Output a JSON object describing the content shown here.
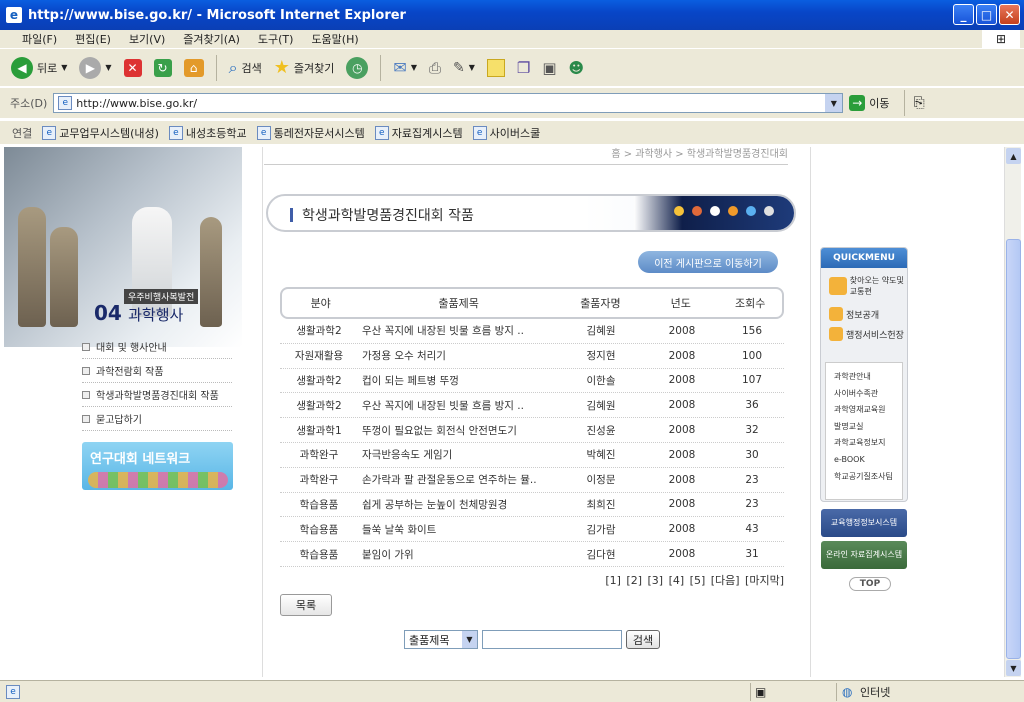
{
  "window": {
    "title": "http://www.bise.go.kr/ - Microsoft Internet Explorer"
  },
  "menu": [
    "파일(F)",
    "편집(E)",
    "보기(V)",
    "즐겨찾기(A)",
    "도구(T)",
    "도움말(H)"
  ],
  "toolbar": {
    "back": "뒤로",
    "search": "검색",
    "favorites": "즐겨찾기"
  },
  "address": {
    "label": "주소(D)",
    "url": "http://www.bise.go.kr/",
    "go": "이동"
  },
  "links": {
    "label": "연결",
    "items": [
      "교무업무시스템(내성)",
      "내성초등학교",
      "통레전자문서시스템",
      "자료집계시스템",
      "사이버스쿨"
    ]
  },
  "left": {
    "hero_label": "우주비행사복발전",
    "section_num": "04",
    "section_title": "과학행사",
    "menu": [
      "대회 및 행사안내",
      "과학전람회 작품",
      "학생과학발명품경진대회 작품",
      "묻고답하기"
    ],
    "banner": "연구대회 네트워크"
  },
  "breadcrumb": "홈 > 과학행사 > 학생과학발명품경진대회",
  "page_title": "학생과학발명품경진대회 작품",
  "prev_board_button": "이전 게시판으로 이동하기",
  "table": {
    "headers": [
      "분야",
      "출품제목",
      "출품자명",
      "년도",
      "조회수"
    ],
    "rows": [
      [
        "생활과학2",
        "우산 꼭지에 내장된 빗물 흐름 방지 ..",
        "김혜원",
        "2008",
        "156"
      ],
      [
        "자원재활용",
        "가정용 오수 처리기",
        "정지현",
        "2008",
        "100"
      ],
      [
        "생활과학2",
        "컵이 되는 페트병 뚜껑",
        "이한솔",
        "2008",
        "107"
      ],
      [
        "생활과학2",
        "우산 꼭지에 내장된 빗물 흐름 방지 ..",
        "김혜원",
        "2008",
        "36"
      ],
      [
        "생활과학1",
        "뚜껑이 필요없는 회전식 안전면도기",
        "진성윤",
        "2008",
        "32"
      ],
      [
        "과학완구",
        "자극반응속도 게임기",
        "박혜진",
        "2008",
        "30"
      ],
      [
        "과학완구",
        "손가락과 팔 관절운동으로 연주하는 뮬..",
        "이정문",
        "2008",
        "23"
      ],
      [
        "학습용품",
        "쉽게 공부하는 눈높이 천체망원경",
        "최희진",
        "2008",
        "23"
      ],
      [
        "학습용품",
        "들쑥 날쑥 화이트",
        "김가람",
        "2008",
        "43"
      ],
      [
        "학습용품",
        "붙임이 가위",
        "김다현",
        "2008",
        "31"
      ]
    ]
  },
  "pager": "[1] [2] [3] [4] [5] [다음] [마지막]",
  "list_button": "목록",
  "search": {
    "field": "출품제목",
    "button": "검색"
  },
  "quick": {
    "header": "QUICKMENU",
    "items": [
      "찾아오는 약도및교통편",
      "정보공개",
      "행정서비스헌장"
    ],
    "links": [
      "과학관안내",
      "사이버수족관",
      "과학영재교육원",
      "발명교실",
      "과학교육정보지",
      "e-BOOK",
      "학교공기질조사팀"
    ],
    "btn1": "교육행정정보시스템",
    "btn2": "온라인 자료집계시스템",
    "top": "TOP"
  },
  "status": {
    "zone": "인터넷"
  },
  "colors": {
    "titlebar": "#0a5ee0",
    "accent": "#3f5da8",
    "chrome": "#ece9d8"
  }
}
